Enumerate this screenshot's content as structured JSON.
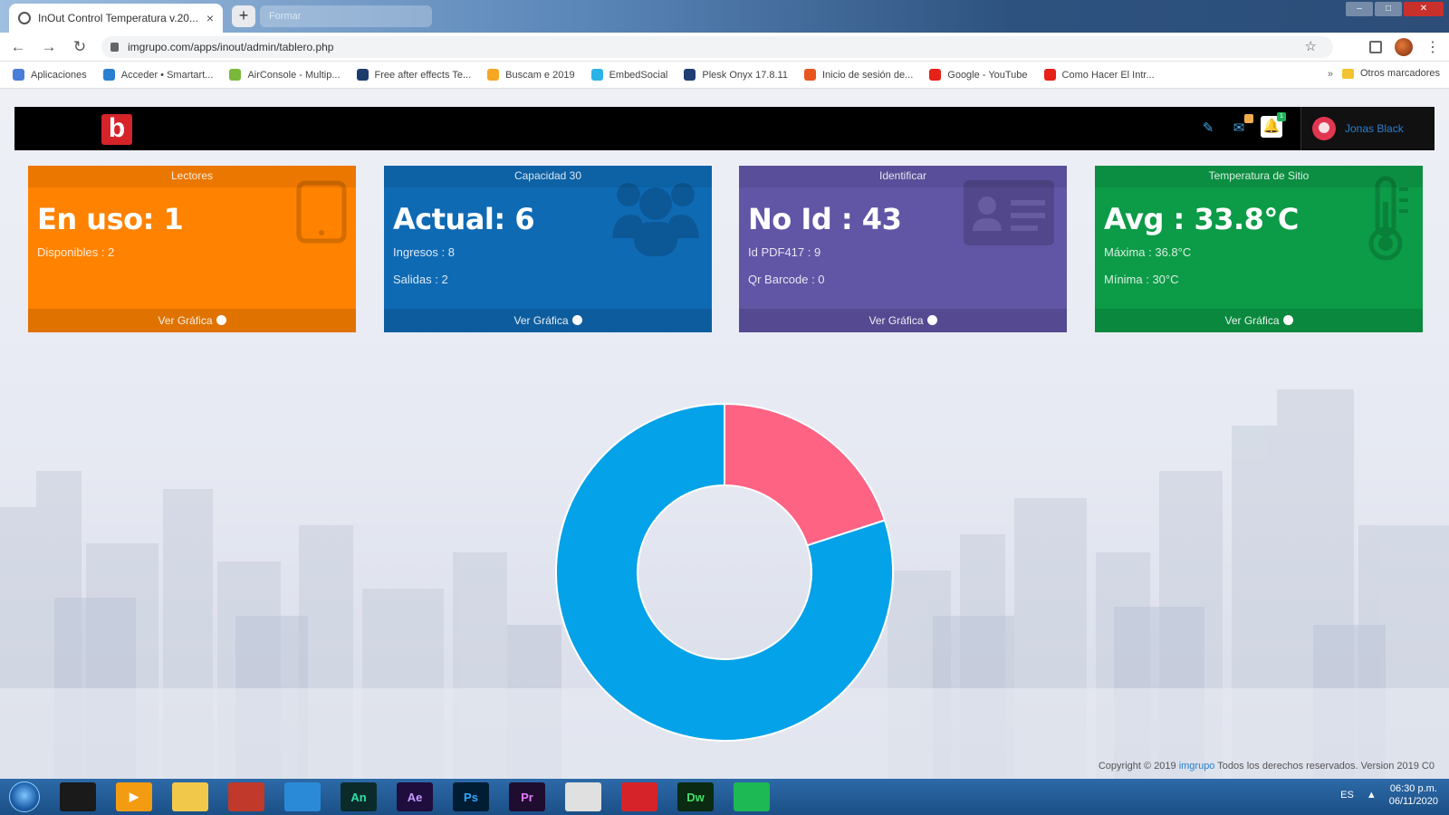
{
  "browser": {
    "tab_title": "InOut Control Temperatura v.20...",
    "tab_close": "×",
    "new_tab": "+",
    "ghost_tab": "Formar",
    "url": "imgrupo.com/apps/inout/admin/tablero.php",
    "bookmarks": [
      {
        "label": "Aplicaciones",
        "color": "#4a7ed9"
      },
      {
        "label": "Acceder • Smartart...",
        "color": "#2a7fd0"
      },
      {
        "label": "AirConsole - Multip...",
        "color": "#7ab83a"
      },
      {
        "label": "Free after effects Te...",
        "color": "#1d3c6e"
      },
      {
        "label": "Buscam e 2019",
        "color": "#f5a623"
      },
      {
        "label": "EmbedSocial",
        "color": "#2ab3e6"
      },
      {
        "label": "Plesk Onyx 17.8.11",
        "color": "#1f3e73"
      },
      {
        "label": "Inicio de sesión de...",
        "color": "#e8561f"
      },
      {
        "label": "Google - YouTube",
        "color": "#e62117"
      },
      {
        "label": "Como Hacer El Intr...",
        "color": "#e62117"
      }
    ],
    "bookmarks_more": "»",
    "other_bookmarks": "Otros marcadores"
  },
  "header": {
    "logo_letter": "b",
    "tools_icon": "wrench-icon",
    "messages_badge": "",
    "notifications_badge": "1",
    "username": "Jonas Black"
  },
  "cards": [
    {
      "title": "Lectores",
      "big": "En uso: 1",
      "lines": [
        "Disponibles : 2"
      ],
      "footer": "Ver Gráfica",
      "color": "#ff8200",
      "icon": "tablet-icon"
    },
    {
      "title": "Capacidad 30",
      "big": "Actual: 6",
      "lines": [
        "Ingresos : 8",
        "Salidas : 2"
      ],
      "footer": "Ver Gráfica",
      "color": "#0f6ab4",
      "icon": "users-icon"
    },
    {
      "title": "Identificar",
      "big": "No Id : 43",
      "lines": [
        "Id PDF417 : 9",
        "Qr Barcode : 0"
      ],
      "footer": "Ver Gráfica",
      "color": "#6155a6",
      "icon": "id-card-icon"
    },
    {
      "title": "Temperatura de Sitio",
      "big": "Avg : 33.8°C",
      "lines": [
        "Máxima : 36.8°C",
        "Mínima : 30°C"
      ],
      "footer": "Ver Gráfica",
      "color": "#0c9b47",
      "icon": "thermometer-icon"
    }
  ],
  "chart_data": {
    "type": "pie",
    "donut": true,
    "values": [
      20,
      80
    ],
    "colors": [
      "#fe6384",
      "#04a2e8"
    ]
  },
  "footer": {
    "copyright_prefix": "Copyright © 2019",
    "company": "imgrupo",
    "copyright_suffix": "Todos los derechos reservados. Version 2019 C0"
  },
  "taskbar": {
    "apps": [
      {
        "label": "",
        "color": "#1a1a1a",
        "fg": "#fff",
        "icon": "game-icon"
      },
      {
        "label": "▶",
        "color": "#f39c12",
        "fg": "#fff",
        "icon": "media-player-icon"
      },
      {
        "label": "",
        "color": "#f2c84b",
        "fg": "#333",
        "icon": "folder-icon"
      },
      {
        "label": "",
        "color": "#c0392b",
        "fg": "#fff",
        "icon": "app-red-icon"
      },
      {
        "label": "",
        "color": "#2b8ad8",
        "fg": "#fff",
        "icon": "outlook-icon"
      },
      {
        "label": "An",
        "color": "#0b2b2b",
        "fg": "#33e0a8",
        "icon": "animate-icon"
      },
      {
        "label": "Ae",
        "color": "#1f0d3d",
        "fg": "#c59bff",
        "icon": "after-effects-icon"
      },
      {
        "label": "Ps",
        "color": "#001d33",
        "fg": "#33a8ff",
        "icon": "photoshop-icon"
      },
      {
        "label": "Pr",
        "color": "#1f0d30",
        "fg": "#e47bff",
        "icon": "premiere-icon"
      },
      {
        "label": "",
        "color": "#e0e0e0",
        "fg": "#333",
        "icon": "chrome-icon"
      },
      {
        "label": "",
        "color": "#d6232a",
        "fg": "#fff",
        "icon": "acrobat-icon"
      },
      {
        "label": "Dw",
        "color": "#0a2a12",
        "fg": "#45e06b",
        "icon": "dreamweaver-icon"
      },
      {
        "label": "",
        "color": "#1db954",
        "fg": "#000",
        "icon": "spotify-icon"
      }
    ],
    "lang": "ES",
    "time": "06:30 p.m.",
    "date": "06/11/2020"
  }
}
